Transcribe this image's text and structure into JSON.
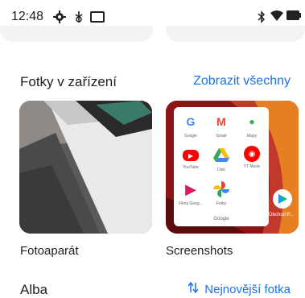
{
  "status_bar": {
    "time": "12:48",
    "battery_label": "100"
  },
  "section": {
    "title": "Fotky v zařízení",
    "view_all": "Zobrazit všechny"
  },
  "folders": [
    {
      "label": "Fotoaparát"
    },
    {
      "label": "Screenshots"
    }
  ],
  "screenshot_thumb": {
    "apps": [
      {
        "name": "Google",
        "glyph": "G",
        "color": "#4285f4"
      },
      {
        "name": "Gmail",
        "glyph": "M",
        "color": "#ea4335"
      },
      {
        "name": "Mapy",
        "glyph": "⬤",
        "color": "#34a853"
      },
      {
        "name": "YouTube",
        "glyph": "▶",
        "color": "#ff0000"
      },
      {
        "name": "Disk",
        "glyph": "▲",
        "color": "#fbbc04"
      },
      {
        "name": "YT Music",
        "glyph": "◉",
        "color": "#ff0000"
      },
      {
        "name": "Filmy Goog...",
        "glyph": "▶",
        "color": "#d81b60"
      },
      {
        "name": "Fotky",
        "glyph": "✱",
        "color": "#4285f4"
      }
    ],
    "folder_name": "Google",
    "extra_app": "Obchod P..."
  },
  "albums": {
    "title": "Alba",
    "sort_label": "Nejnovější fotka"
  },
  "colors": {
    "accent": "#1a73e8",
    "text": "#202124"
  }
}
